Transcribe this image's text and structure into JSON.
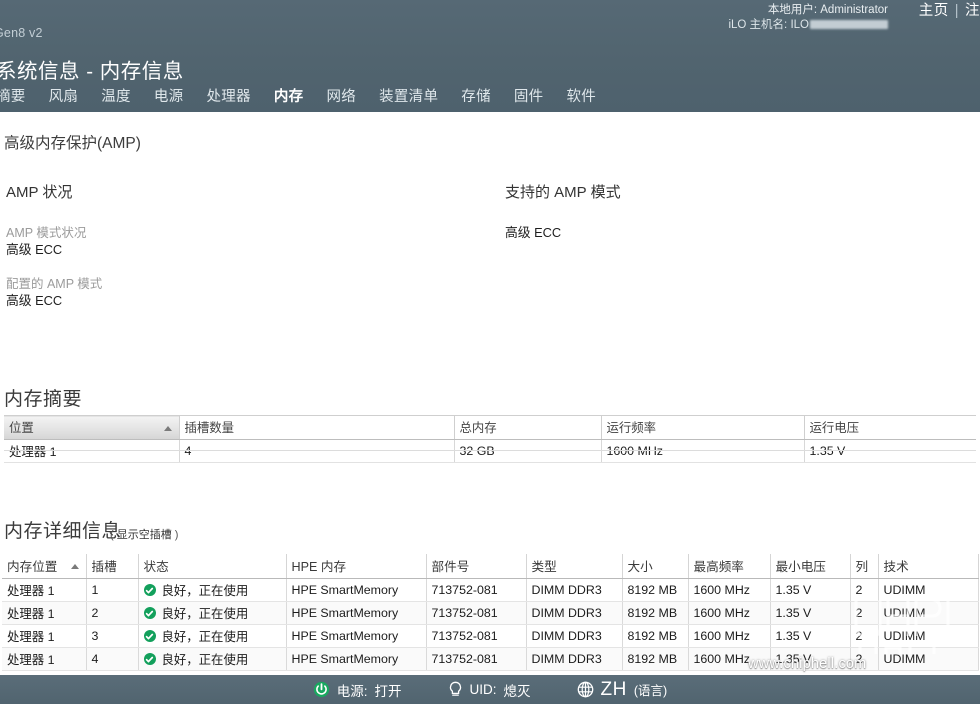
{
  "header": {
    "model": "Gen8 v2",
    "page_title": "系统信息 - 内存信息",
    "local_user_label": "本地用户:",
    "local_user_value": "Administrator",
    "ilo_hostname_label": "iLO 主机名:",
    "ilo_hostname_value": "ILO",
    "link_home": "主页",
    "link_separator": "|",
    "link_logout": "注",
    "bg_color": "#51646f"
  },
  "tabs": [
    {
      "label": "摘要",
      "active": false
    },
    {
      "label": "风扇",
      "active": false
    },
    {
      "label": "温度",
      "active": false
    },
    {
      "label": "电源",
      "active": false
    },
    {
      "label": "处理器",
      "active": false
    },
    {
      "label": "内存",
      "active": true
    },
    {
      "label": "网络",
      "active": false
    },
    {
      "label": "装置清单",
      "active": false
    },
    {
      "label": "存储",
      "active": false
    },
    {
      "label": "固件",
      "active": false
    },
    {
      "label": "软件",
      "active": false
    }
  ],
  "amp": {
    "section_title": "高级内存保护(AMP)",
    "status_heading": "AMP 状况",
    "supported_heading": "支持的 AMP 模式",
    "mode_status_label": "AMP 模式状况",
    "mode_status_value": "高级 ECC",
    "configured_label": "配置的 AMP 模式",
    "configured_value": "高级 ECC",
    "supported_value": "高级 ECC"
  },
  "memory_summary": {
    "title": "内存摘要",
    "columns": [
      "位置",
      "插槽数量",
      "总内存",
      "运行频率",
      "运行电压"
    ],
    "sorted_column_index": 0,
    "sort_direction": "asc",
    "rows": [
      [
        "处理器 1",
        "4",
        "32 GB",
        "1600 MHz",
        "1.35 V"
      ]
    ]
  },
  "memory_detail": {
    "title": "内存详细信息",
    "sub_link": "显示空插槽",
    "sub_link_open": "(",
    "sub_link_close": ")",
    "columns": [
      "内存位置",
      "插槽",
      "状态",
      "HPE 内存",
      "部件号",
      "类型",
      "大小",
      "最高频率",
      "最小电压",
      "列",
      "技术"
    ],
    "sorted_column_index": 0,
    "sort_direction": "asc",
    "status_ok_color": "#13a05c",
    "rows": [
      [
        "处理器 1",
        "1",
        "良好，正在使用",
        "HPE SmartMemory",
        "713752-081",
        "DIMM DDR3",
        "8192 MB",
        "1600 MHz",
        "1.35 V",
        "2",
        "UDIMM"
      ],
      [
        "处理器 1",
        "2",
        "良好，正在使用",
        "HPE SmartMemory",
        "713752-081",
        "DIMM DDR3",
        "8192 MB",
        "1600 MHz",
        "1.35 V",
        "2",
        "UDIMM"
      ],
      [
        "处理器 1",
        "3",
        "良好，正在使用",
        "HPE SmartMemory",
        "713752-081",
        "DIMM DDR3",
        "8192 MB",
        "1600 MHz",
        "1.35 V",
        "2",
        "UDIMM"
      ],
      [
        "处理器 1",
        "4",
        "良好，正在使用",
        "HPE SmartMemory",
        "713752-081",
        "DIMM DDR3",
        "8192 MB",
        "1600 MHz",
        "1.35 V",
        "2",
        "UDIMM"
      ]
    ]
  },
  "watermark": {
    "text": "www.chiphell.com"
  },
  "status_bar": {
    "power_label": "电源:",
    "power_value": "打开",
    "uid_label": "UID:",
    "uid_value": "熄灭",
    "language_code": "ZH",
    "language_word": "(语言)",
    "power_on_color": "#19a85f"
  }
}
